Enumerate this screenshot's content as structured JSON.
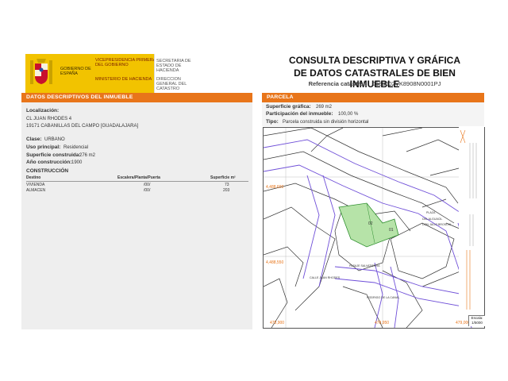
{
  "header": {
    "gov_name": "GOBIERNO DE ESPAÑA",
    "vicepresidencia": "VICEPRESIDENCIA PRIMERA DEL GOBIERNO",
    "ministerio": "MINISTERIO DE HACIENDA",
    "secretaria": "SECRETARIA DE ESTADO DE HACIENDA",
    "direccion": "DIRECCION GENERAL DEL CATASTRO"
  },
  "title": {
    "line1": "CONSULTA DESCRIPTIVA Y GRÁFICA",
    "line2": "DE DATOS CATASTRALES DE BIEN INMUEBLE",
    "ref_label": "Referencia catastral:",
    "ref_value": "0188602VK8908N0001PJ"
  },
  "left": {
    "section_title": "DATOS DESCRIPTIVOS DEL INMUEBLE",
    "localizacion_label": "Localización:",
    "address1": "CL JUAN RHODES 4",
    "address2": "19171 CABANILLAS DEL CAMPO [GUADALAJARA]",
    "clase_label": "Clase:",
    "clase_value": "URBANO",
    "uso_label": "Uso principal:",
    "uso_value": "Residencial",
    "superficie_label": "Superficie construida:",
    "superficie_value": "276 m2",
    "anio_label": "Año construcción:",
    "anio_value": "1900",
    "construccion_title": "CONSTRUCCIÓN",
    "table_headers": [
      "Destino",
      "Escalera/Planta/Puerta",
      "Superficie m²"
    ],
    "table_rows": [
      [
        "VIVIENDA",
        "/00/",
        "73"
      ],
      [
        "ALMACEN",
        "/00/",
        "203"
      ]
    ]
  },
  "right": {
    "section_title": "PARCELA",
    "grafica_label": "Superficie gráfica:",
    "grafica_value": "269 m2",
    "participacion_label": "Participación del inmueble:",
    "participacion_value": "100,00 %",
    "tipo_label": "Tipo:",
    "tipo_value": "Parcela construida sin división horizontal"
  },
  "map": {
    "coords": [
      "4,488,600",
      "4,488,550",
      "4,488,500",
      "478,900",
      "478,950",
      "479,000"
    ],
    "streets": [
      "PLAZA",
      "DEL ALGUACIL",
      "DON JULIO",
      "BROSCHI",
      "CALLE JUAN RHODES",
      "PASAJE SALVATIERRA",
      "RODRIGO DE LA CANAL"
    ],
    "parcel_labels": [
      "02",
      "01"
    ],
    "scale_label": "Escala:",
    "scale_value": "1/5000",
    "parcel_color": "#b6e3a8",
    "line_color": "#e8751a"
  }
}
